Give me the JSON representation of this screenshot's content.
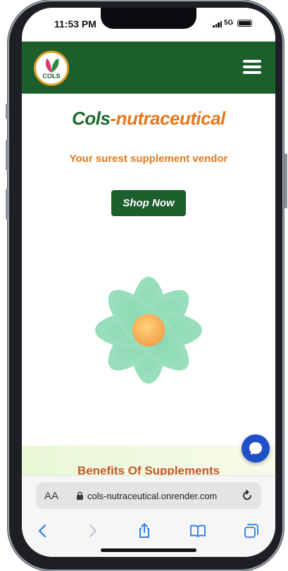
{
  "status_bar": {
    "time": "11:53 PM",
    "network": "5G"
  },
  "header": {
    "logo_text": "COLS",
    "logo_icon": "leaf-logo-icon",
    "menu_icon": "hamburger-menu-icon"
  },
  "hero": {
    "brand_part1": "Cols",
    "brand_part2": "-nutraceutical",
    "tagline": "Your surest supplement vendor",
    "shop_button": "Shop Now"
  },
  "benefits": {
    "title": "Benefits Of Supplements"
  },
  "browser": {
    "text_size_label": "AA",
    "url": "cols-nutraceutical.onrender.com"
  },
  "colors": {
    "brand_green": "#1c5e2c",
    "accent_orange": "#e8771c",
    "chat_blue": "#1f50c7"
  }
}
